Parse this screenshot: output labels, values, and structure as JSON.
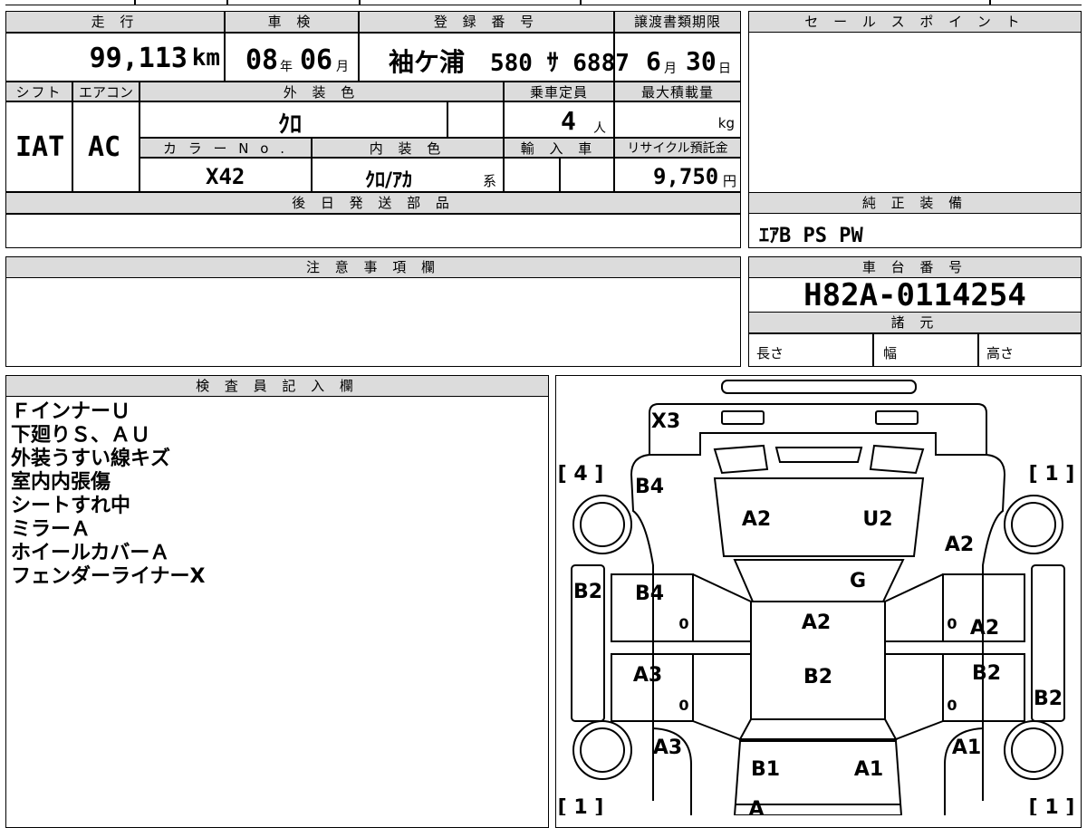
{
  "header": {
    "mileage_label": "走 行",
    "mileage_value": "99,113",
    "mileage_unit": "km",
    "inspection_label": "車 検",
    "inspection_year": "08",
    "inspection_year_unit": "年",
    "inspection_month": "06",
    "inspection_month_unit": "月",
    "registration_label": "登 録 番 号",
    "registration_place": "袖ケ浦",
    "registration_number": "580 ｻ 6887",
    "transfer_deadline_label": "譲渡書類期限",
    "transfer_month": "6",
    "transfer_month_unit": "月",
    "transfer_day": "30",
    "transfer_day_unit": "日",
    "sales_point_label": "セ ー ル ス ポ イ ン ト"
  },
  "row2": {
    "shift_label": "シフト",
    "shift_value": "IAT",
    "aircon_label": "エアコン",
    "aircon_value": "AC",
    "exterior_color_label": "外 装 色",
    "exterior_color_value": "ｸﾛ",
    "capacity_label": "乗車定員",
    "capacity_value": "4",
    "capacity_unit": "人",
    "max_load_label": "最大積載量",
    "max_load_unit": "kg",
    "color_no_label": "カ ラ ー N o .",
    "color_no_value": "X42",
    "interior_color_label": "内 装 色",
    "interior_color_value": "ｸﾛ/ｱｶ",
    "interior_color_suffix": "系",
    "import_label": "輸 入 車",
    "recycle_label": "リサイクル預託金",
    "recycle_value": "9,750",
    "recycle_unit": "円"
  },
  "later_parts": {
    "label": "後 日 発 送 部 品"
  },
  "genuine_equipment": {
    "label": "純 正 装 備",
    "value": "ｴｱB PS PW"
  },
  "caution": {
    "label": "注 意 事 項 欄"
  },
  "chassis": {
    "label": "車 台 番 号",
    "value": "H82A-0114254"
  },
  "specs": {
    "label": "諸 元",
    "length": "長さ",
    "width": "幅",
    "height": "高さ"
  },
  "inspector": {
    "label": "検 査 員 記 入 欄",
    "lines": [
      "ＦインナーＵ",
      "下廻りＳ、ＡＵ",
      "外装うすい線キズ",
      "室内内張傷",
      "シートすれ中",
      "ミラーＡ",
      "ホイールカバーＡ",
      "フェンダーライナーX"
    ]
  },
  "diagram": {
    "tire_fl": "[ 4 ]",
    "tire_fr": "[ 1 ]",
    "tire_rl": "[ 1 ]",
    "tire_rr": "[ 1 ]",
    "marks": {
      "front_bumper": "X3",
      "front_left_fender": "B4",
      "hood_left": "A2",
      "hood_right": "U2",
      "front_right_fender": "A2",
      "front_left_side": "B2",
      "front_left_door": "B4",
      "windshield": "G",
      "roof_front": "A2",
      "front_right_door": "A2",
      "rear_left_door": "A3",
      "roof_rear": "B2",
      "rear_right_door": "B2",
      "rear_right_side": "B2",
      "rear_left_fender": "A3",
      "trunk_left": "B1",
      "trunk_right": "A1",
      "rear_right_fender": "A1",
      "rear_bumper": "A",
      "door_zero_1": "0",
      "door_zero_2": "0",
      "door_zero_3": "0",
      "door_zero_4": "0"
    }
  }
}
